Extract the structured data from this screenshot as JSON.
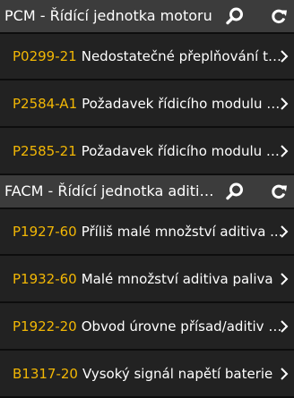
{
  "groups": [
    {
      "title": "PCM - Řídící jednotka motoru",
      "items": [
        {
          "code": "P0299-21",
          "desc": "Nedostatečné přeplňování tu..."
        },
        {
          "code": "P2584-A1",
          "desc": "Požadavek řídicího modulu p..."
        },
        {
          "code": "P2585-21",
          "desc": "Požadavek řídicího modulu p..."
        }
      ]
    },
    {
      "title": "FACM - Řídící jednotka aditiva...",
      "items": [
        {
          "code": "P1927-60",
          "desc": "Příliš malé množství aditiva ..."
        },
        {
          "code": "P1932-60",
          "desc": "Malé množství aditiva paliva"
        },
        {
          "code": "P1922-20",
          "desc": "Obvod úrovne přísad/aditiv p..."
        },
        {
          "code": "B1317-20",
          "desc": "Vysoký signál napětí baterie"
        }
      ]
    }
  ],
  "icons": {
    "search": "search-icon",
    "refresh": "refresh-icon",
    "chevron": "chevron-right-icon"
  },
  "colors": {
    "code": "#f2b705",
    "header_bg": "#3c3c3c",
    "row_bg": "#222222"
  }
}
